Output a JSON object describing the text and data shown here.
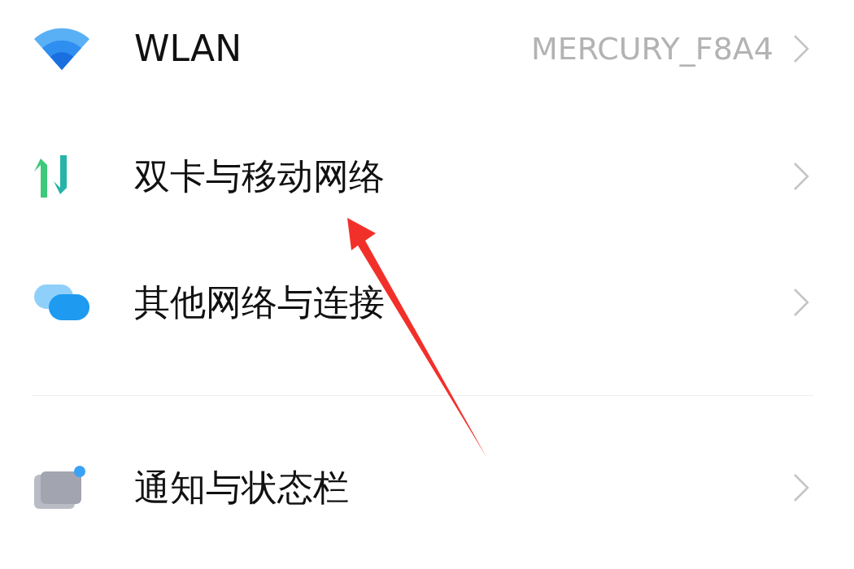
{
  "settings": [
    {
      "kind": "wifi",
      "label": "WLAN",
      "value": "MERCURY_F8A4",
      "divider_before": false
    },
    {
      "kind": "sim",
      "label": "双卡与移动网络",
      "divider_before": false
    },
    {
      "kind": "connections",
      "label": "其他网络与连接",
      "divider_before": false
    },
    {
      "kind": "notifications",
      "label": "通知与状态栏",
      "divider_before": true
    }
  ]
}
